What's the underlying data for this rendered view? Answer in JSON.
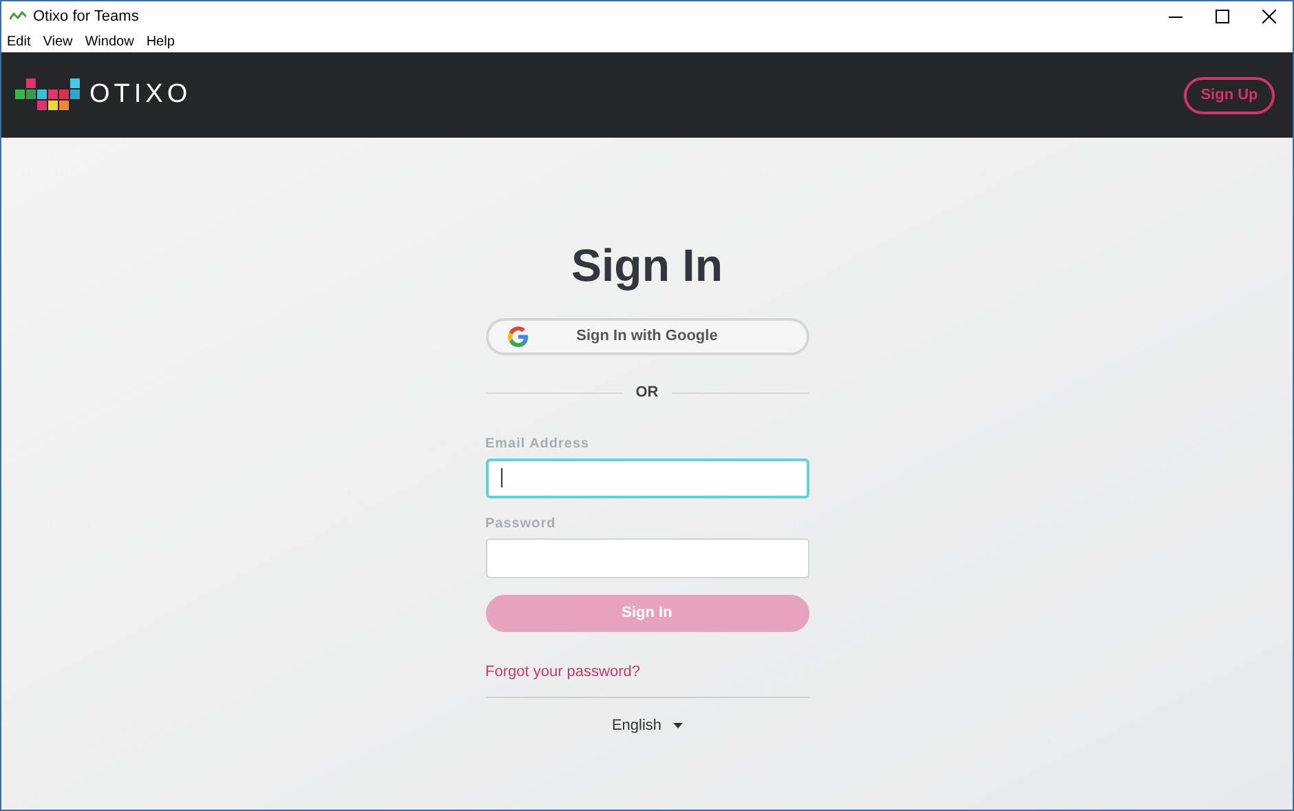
{
  "window": {
    "title": "Otixo for Teams"
  },
  "menu": [
    "Edit",
    "View",
    "Window",
    "Help"
  ],
  "header": {
    "logo_text": "OTIXO",
    "signup": "Sign Up"
  },
  "form": {
    "title": "Sign In",
    "google": "Sign In with Google",
    "divider": "OR",
    "fields": [
      {
        "label": "Email Address",
        "focused": true
      },
      {
        "label": "Password",
        "focused": false
      }
    ],
    "submit": {
      "label": "Sign In",
      "disabled": true
    },
    "forgot": "Forgot your password?",
    "language": "English"
  }
}
